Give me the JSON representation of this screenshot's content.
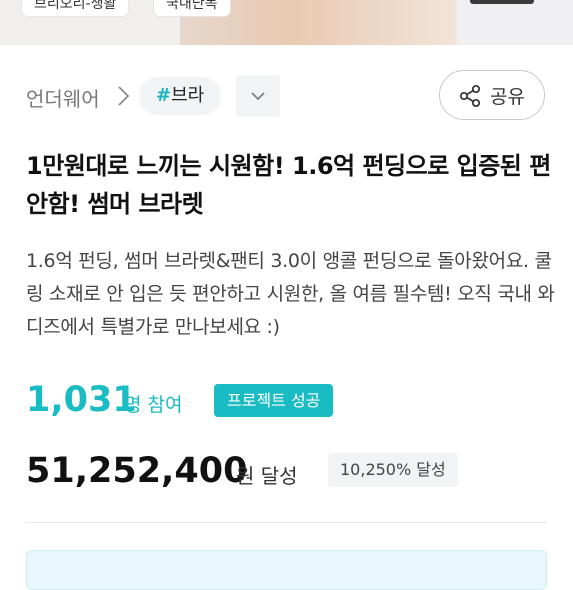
{
  "top_images": {
    "chip_left": "브리오리-생활",
    "chip_right": "국내단독"
  },
  "breadcrumb": {
    "category": "언더웨어",
    "tag_hash": "#",
    "tag_label": "브라"
  },
  "share": {
    "label": "공유"
  },
  "project": {
    "title": "1만원대로 느끼는 시원함! 1.6억 펀딩으로 입증된 편안함! 썸머 브라렛",
    "description": "1.6억 펀딩, 썸머 브라렛&팬티 3.0이 앵콜 펀딩으로 돌아왔어요. 쿨링 소재로 안 입은 듯 편안하고 시원한, 올 여름 필수템! 오직 국내 와디즈에서 특별가로 만나보세요 :)"
  },
  "stats": {
    "participants": "1,031",
    "participants_unit": "명 참여",
    "status_badge": "프로젝트 성공",
    "amount": "51,252,400",
    "amount_unit": "원 달성",
    "percent_badge": "10,250% 달성"
  },
  "colors": {
    "accent": "#19bcc3",
    "text_primary": "#111111",
    "badge_bg": "#f1f3f5"
  }
}
